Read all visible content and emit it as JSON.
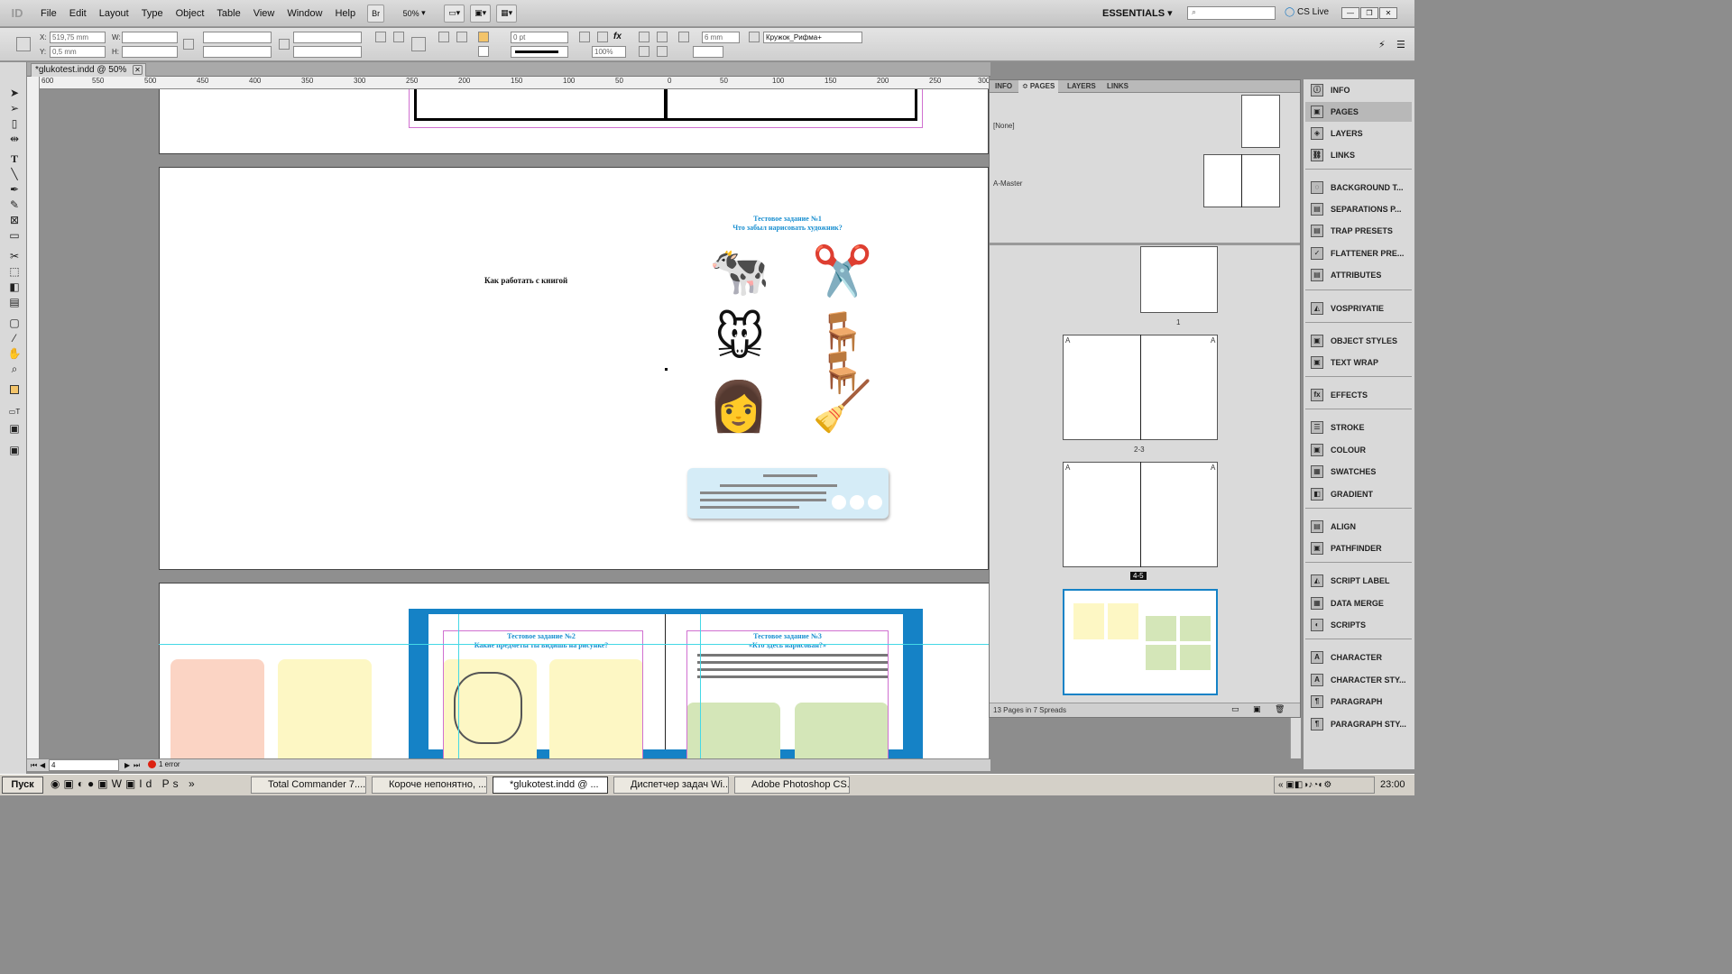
{
  "app": {
    "logo": "ID",
    "menus": [
      "File",
      "Edit",
      "Layout",
      "Type",
      "Object",
      "Table",
      "View",
      "Window",
      "Help"
    ],
    "bridge_label": "Br",
    "zoom": "50%",
    "workspace": "ESSENTIALS",
    "search_placeholder": "",
    "cslive": "CS Live",
    "window_buttons": [
      "—",
      "❐",
      "✕"
    ]
  },
  "control": {
    "x_label": "X:",
    "x_value": "519,75 mm",
    "y_label": "Y:",
    "y_value": "0,5 mm",
    "w_label": "W:",
    "h_label": "H:",
    "stroke_weight": "0 pt",
    "opacity": "100%",
    "gap_value": "6 mm",
    "style_name": "Кружок_Рифма+"
  },
  "document": {
    "tab_title": "*glukotest.indd @ 50%",
    "close": "✕"
  },
  "ruler": {
    "ticks": [
      "600",
      "550",
      "500",
      "450",
      "400",
      "350",
      "300",
      "250",
      "200",
      "150",
      "100",
      "50",
      "0",
      "50",
      "100",
      "150",
      "200",
      "250",
      "300"
    ]
  },
  "pages": {
    "spread1_title": "Тестовое задание №1",
    "spread1_subtitle": "Что забыл нарисовать художник?",
    "left_caption": "Как работать с книгой",
    "task2_title": "Тестовое задание №2",
    "task2_subtitle": "Какие предметы ты видишь на рисунке?",
    "task3_title": "Тестовое задание №3",
    "task3_subtitle": "«Кто здесь нарисован?»"
  },
  "status": {
    "page": "4",
    "errors": "1 error"
  },
  "pages_panel": {
    "tabs": [
      "INFO",
      "≎ PAGES",
      "LAYERS",
      "LINKS"
    ],
    "none_master": "[None]",
    "a_master": "A-Master",
    "labels": [
      "1",
      "2-3",
      "4-5"
    ],
    "master_letter": "A",
    "footer": "13 Pages in 7 Spreads"
  },
  "dock": {
    "items": [
      "INFO",
      "PAGES",
      "LAYERS",
      "LINKS",
      "BACKGROUND T...",
      "SEPARATIONS P...",
      "TRAP PRESETS",
      "FLATTENER PRE...",
      "ATTRIBUTES",
      "VOSPRIYATIE",
      "OBJECT STYLES",
      "TEXT WRAP",
      "EFFECTS",
      "STROKE",
      "COLOUR",
      "SWATCHES",
      "GRADIENT",
      "ALIGN",
      "PATHFINDER",
      "SCRIPT LABEL",
      "DATA MERGE",
      "SCRIPTS",
      "CHARACTER",
      "CHARACTER STY...",
      "PARAGRAPH",
      "PARAGRAPH STY..."
    ],
    "icons": [
      "ⓘ",
      "▣",
      "◈",
      "⛓",
      "◌",
      "▤",
      "▤",
      "✓",
      "▤",
      "◭",
      "▣",
      "▣",
      "fx",
      "☰",
      "▣",
      "▦",
      "◧",
      "▤",
      "▣",
      "◭",
      "▦",
      "◐",
      "A",
      "A",
      "¶",
      "¶"
    ]
  },
  "taskbar": {
    "start": "Пуск",
    "tasks": [
      "Total Commander 7....",
      "Короче непонятно, ...",
      "*glukotest.indd @ ...",
      "Диспетчер задач Wi...",
      "Adobe Photoshop CS..."
    ],
    "clock": "23:00"
  }
}
